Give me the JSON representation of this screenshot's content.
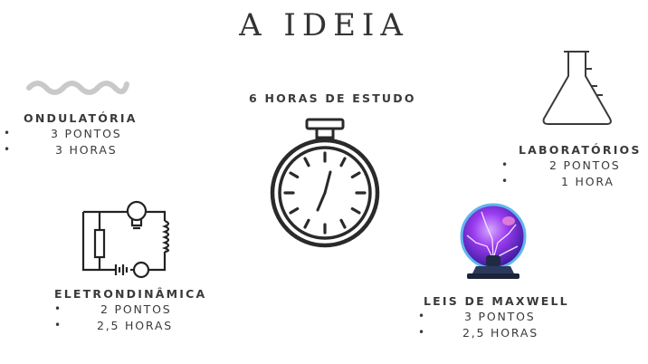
{
  "title": "A IDEIA",
  "center": {
    "heading": "6 HORAS DE ESTUDO",
    "icon": "stopwatch-icon"
  },
  "topics": [
    {
      "id": "ondulatoria",
      "heading": "ONDULATÓRIA",
      "items": [
        "3 PONTOS",
        "3 HORAS"
      ],
      "icon": "wave-icon"
    },
    {
      "id": "laboratorios",
      "heading": "LABORATÓRIOS",
      "items": [
        "2 PONTOS",
        "1 HORA"
      ],
      "icon": "flask-icon"
    },
    {
      "id": "eletrondinamica",
      "heading": "ELETRONDINÂMICA",
      "items": [
        "2 PONTOS",
        "2,5 HORAS"
      ],
      "icon": "circuit-icon"
    },
    {
      "id": "maxwell",
      "heading": "LEIS DE MAXWELL",
      "items": [
        "3 PONTOS",
        "2,5 HORAS"
      ],
      "icon": "plasma-ball-icon"
    }
  ],
  "colors": {
    "text": "#3a3a3a",
    "wave": "#c9c9c9",
    "plasma": "#7b2fd0"
  }
}
